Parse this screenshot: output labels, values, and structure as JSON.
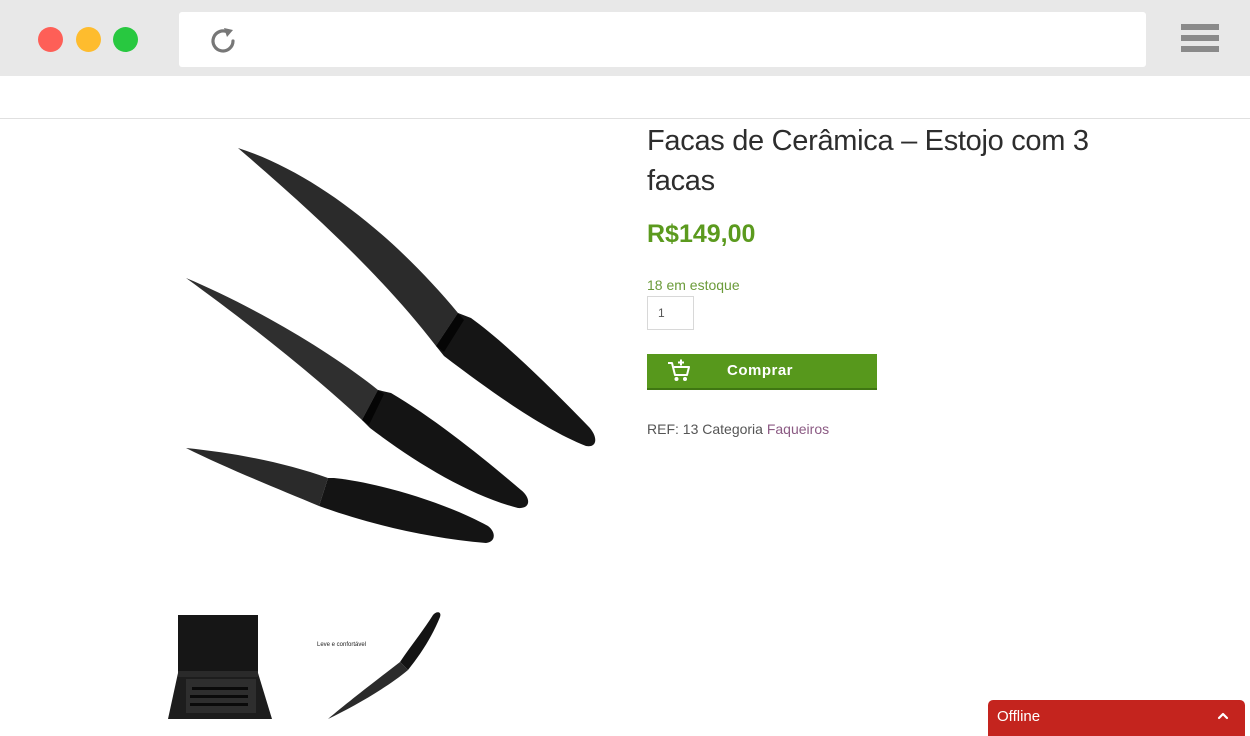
{
  "product": {
    "title": "Facas de Cerâmica – Estojo com 3 facas",
    "price": "R$149,00",
    "stock": "18 em estoque",
    "quantity": "1",
    "buy_label": "Comprar",
    "ref_label": "REF:",
    "ref_value": "13",
    "category_label": "Categoria",
    "category_link": "Faqueiros",
    "thumb2_caption": "Leve e confortável"
  },
  "chat": {
    "label": "Offline"
  },
  "icons": {
    "reload": "reload-icon",
    "menu": "menu-icon",
    "cart": "cart-add-icon",
    "chevron": "chevron-up-icon"
  },
  "colors": {
    "price": "#5b9a1e",
    "buy_button": "#57981c",
    "chat_bar": "#c4241e",
    "category_link": "#8b5a83"
  }
}
